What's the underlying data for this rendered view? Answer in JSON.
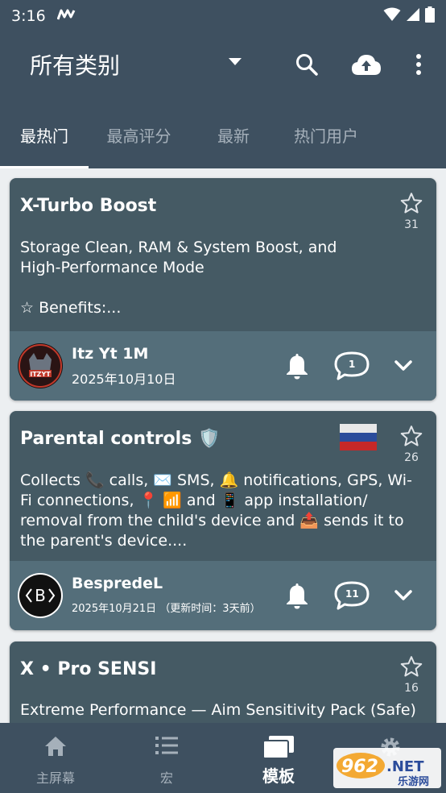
{
  "status_bar": {
    "time": "3:16"
  },
  "app_bar": {
    "title": "所有类别"
  },
  "tabs": [
    {
      "label": "最热门"
    },
    {
      "label": "最高评分"
    },
    {
      "label": "最新"
    },
    {
      "label": "热门用户"
    }
  ],
  "cards": [
    {
      "title": "X-Turbo Boost",
      "description": "Storage Clean, RAM & System Boost, and\nHigh-Performance Mode\n\n☆ Benefits:...",
      "star_count": "31",
      "author": "Itz Yt 1M",
      "date": "2025年10月10日",
      "comment_count": "1"
    },
    {
      "title": "Parental controls 🛡️",
      "description": "Collects 📞 calls, ✉️ SMS, 🔔 notifications, GPS, Wi-Fi connections, 📍 📶 and 📱 app installation/ removal from the child's device and 📤 sends it to the parent's device....",
      "star_count": "26",
      "author": "BespredeL",
      "date": "2025年10月21日 （更新时间：3天前）",
      "comment_count": "11"
    },
    {
      "title": "X • Pro SENSI",
      "description": "Extreme Performance — Aim Sensitivity Pack (Safe)",
      "star_count": "16"
    }
  ],
  "bottom_nav": [
    {
      "label": "主屏幕"
    },
    {
      "label": "宏"
    },
    {
      "label": "模板"
    },
    {
      "label": ""
    }
  ],
  "watermark": {
    "text": "962.NET",
    "subtext": "乐游网"
  },
  "colors": {
    "app_bar": "#3e5060",
    "card": "#455a64",
    "card_footer": "#546e7a",
    "background": "#eceff1"
  }
}
